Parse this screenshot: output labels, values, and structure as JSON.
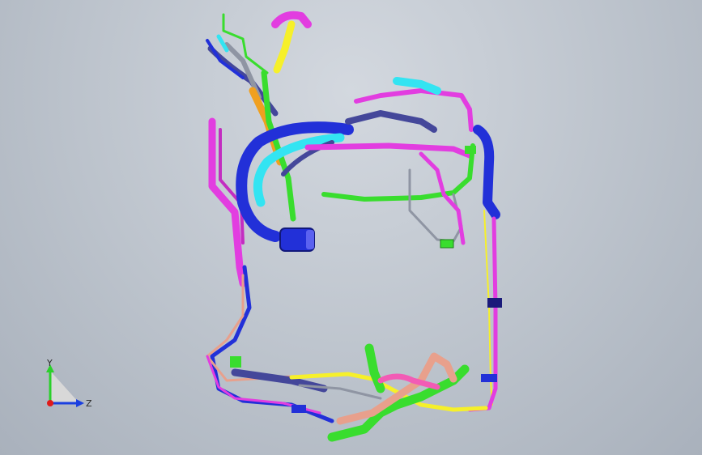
{
  "viewport": {
    "description_label": "",
    "background_color": "#bfc6cf"
  },
  "triad": {
    "y_label": "Y",
    "z_label": "Z",
    "y_color": "#2bd02b",
    "z_color": "#1a3fe0",
    "x_color": "#e01a1a"
  },
  "model": {
    "pipe_colors": {
      "magenta": "#e23de0",
      "blue": "#2230d8",
      "cyan": "#33e4f2",
      "green": "#39dd2e",
      "orange": "#f0a020",
      "yellow": "#f6f02a",
      "navy": "#44479a",
      "salmon": "#e8a08c",
      "gray": "#8f95a3",
      "pink": "#f25bb5"
    }
  }
}
